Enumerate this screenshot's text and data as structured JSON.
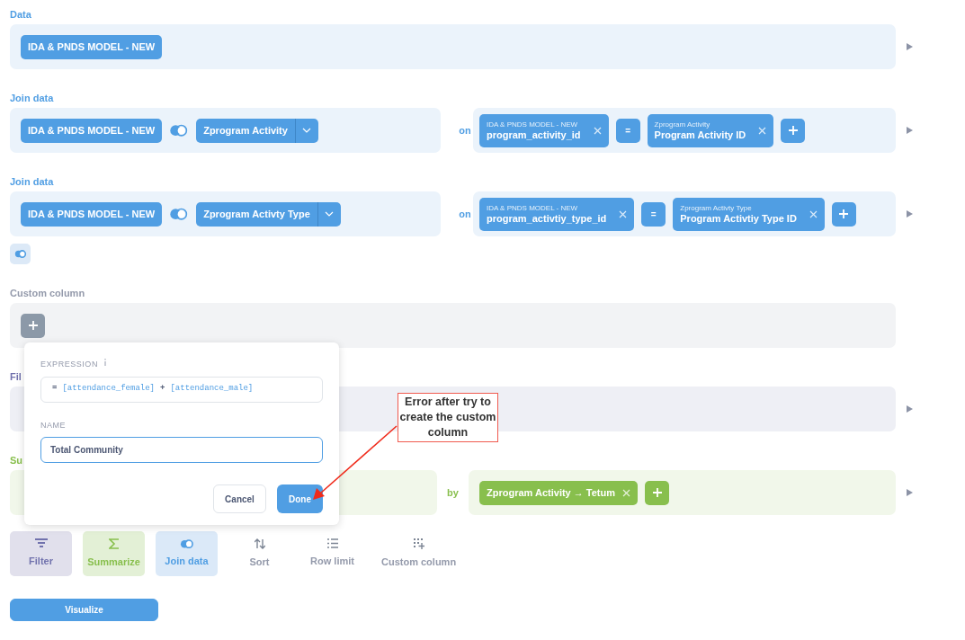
{
  "steps": [
    {
      "kind": "data",
      "label": "Data",
      "table": "IDA & PNDS MODEL - NEW"
    },
    {
      "kind": "join",
      "label": "Join data",
      "left_table": "IDA & PNDS MODEL - NEW",
      "right_table": "Zprogram Activity",
      "on": "on",
      "left_field": {
        "table": "IDA & PNDS MODEL - NEW",
        "column": "program_activity_id"
      },
      "operator": "=",
      "right_field": {
        "table": "Zprogram Activity",
        "column": "Program Activity ID"
      }
    },
    {
      "kind": "join",
      "label": "Join data",
      "left_table": "IDA & PNDS MODEL - NEW",
      "right_table": "Zprogram Activty Type",
      "on": "on",
      "left_field": {
        "table": "IDA & PNDS MODEL - NEW",
        "column": "program_activtiy_type_id"
      },
      "operator": "=",
      "right_field": {
        "table": "Zprogram Activty Type",
        "column": "Program Activtiy Type ID"
      }
    },
    {
      "kind": "join_toggle"
    },
    {
      "kind": "custom_column",
      "label": "Custom column"
    },
    {
      "kind": "filter",
      "label": "Fil"
    },
    {
      "kind": "summarize",
      "label": "Su",
      "by": "by",
      "breakouts": [
        "Zprogram Activity → Tetum"
      ]
    }
  ],
  "actions": [
    {
      "kind": "filter",
      "label": "Filter"
    },
    {
      "kind": "summarize",
      "label": "Summarize"
    },
    {
      "kind": "join",
      "label": "Join data"
    },
    {
      "kind": "sort",
      "label": "Sort"
    },
    {
      "kind": "limit",
      "label": "Row limit"
    },
    {
      "kind": "custom_column",
      "label": "Custom column"
    }
  ],
  "visualize": "Visualize",
  "popover": {
    "expression_label": "EXPRESSION",
    "expression": [
      {
        "kind": "op",
        "text": "="
      },
      {
        "kind": "field",
        "text": "[attendance_female]"
      },
      {
        "kind": "op",
        "text": "+"
      },
      {
        "kind": "field",
        "text": "[attendance_male]"
      }
    ],
    "name_label": "NAME",
    "name_value": "Total Community",
    "cancel": "Cancel",
    "done": "Done"
  },
  "annotation": {
    "text": "Error after try to create the custom column"
  }
}
